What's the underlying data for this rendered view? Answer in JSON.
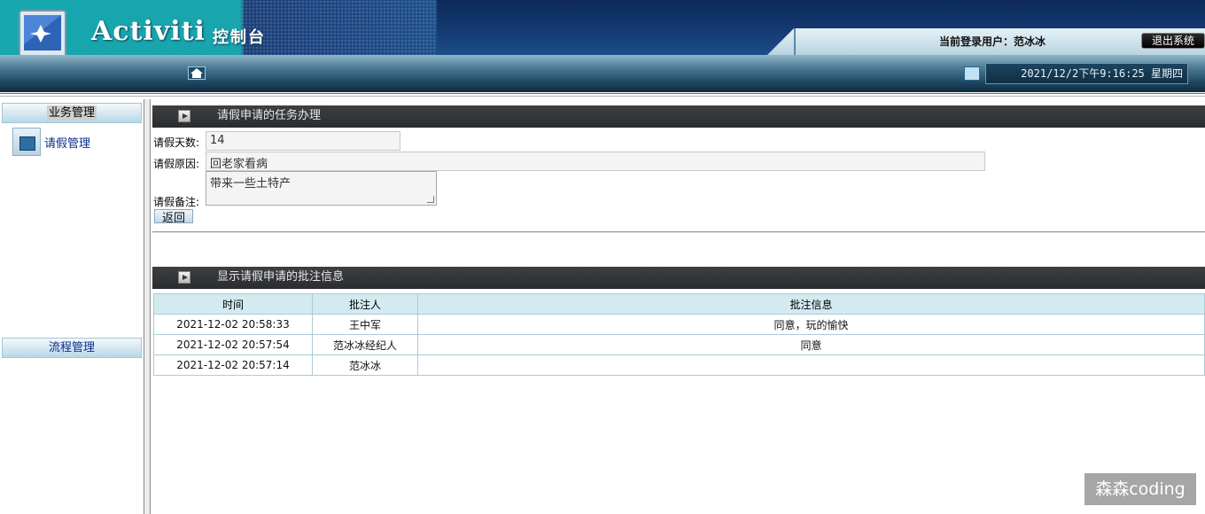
{
  "header": {
    "brand": "Activiti",
    "subtitle": "控制台",
    "user_label": "当前登录用户：范冰冰",
    "logout_label": "退出系统"
  },
  "navbar": {
    "datetime": "2021/12/2下午9:16:25 星期四"
  },
  "sidebar": {
    "sections": [
      {
        "label": "业务管理"
      },
      {
        "label": "流程管理"
      }
    ],
    "items": [
      {
        "label": "请假管理"
      }
    ]
  },
  "task_panel": {
    "title": "请假申请的任务办理",
    "days_label": "请假天数:",
    "days_value": "14",
    "reason_label": "请假原因:",
    "reason_value": "回老家看病",
    "remark_label": "请假备注:",
    "remark_value": "带来一些土特产",
    "back_label": "返回"
  },
  "note_panel": {
    "title": "显示请假申请的批注信息",
    "columns": [
      "时间",
      "批注人",
      "批注信息"
    ],
    "rows": [
      [
        "2021-12-02 20:58:33",
        "王中军",
        "同意，玩的愉快"
      ],
      [
        "2021-12-02 20:57:54",
        "范冰冰经纪人",
        "同意"
      ],
      [
        "2021-12-02 20:57:14",
        "范冰冰",
        ""
      ]
    ]
  },
  "watermark": "森森coding"
}
